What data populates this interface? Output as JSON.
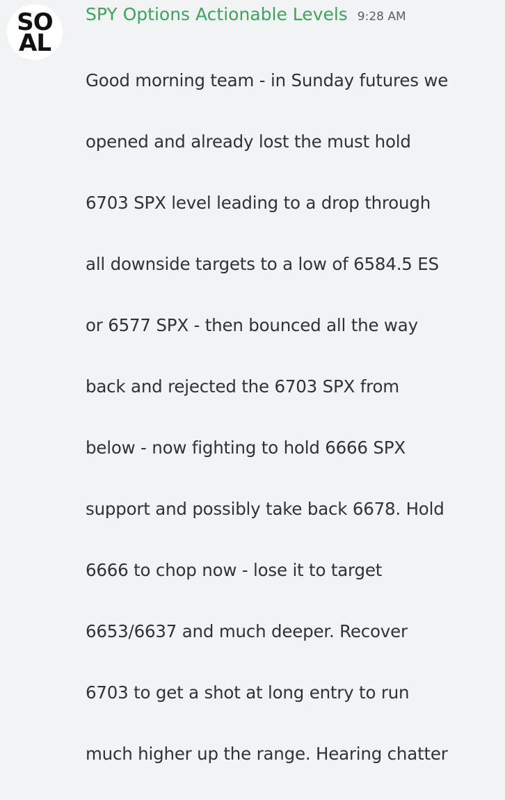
{
  "message": {
    "avatar": {
      "logo_line1": "SO",
      "logo_line2": "AL"
    },
    "author": "SPY Options Actionable Levels",
    "timestamp": "9:28 AM",
    "content_lines": [
      "Good morning team - in Sunday futures we",
      "opened and already lost the must hold",
      "6703 SPX level leading to a drop through",
      "all downside targets to a low of 6584.5 ES",
      "or 6577 SPX - then bounced all the way",
      "back and rejected the 6703 SPX from",
      "below - now fighting to hold 6666 SPX",
      "support and possibly take back 6678. Hold",
      "6666 to chop now - lose it to target",
      "6653/6637 and much deeper. Recover",
      "6703 to get a shot at long entry to run",
      "much higher up the range. Hearing chatter"
    ],
    "colors": {
      "author": "#3ba55c",
      "text": "#2e3338",
      "timestamp": "#5c5e66",
      "background": "#f2f3f5"
    }
  }
}
